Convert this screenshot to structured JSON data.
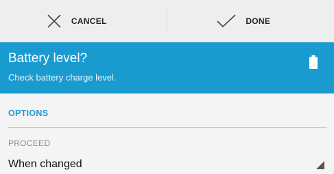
{
  "action_bar": {
    "cancel_label": "CANCEL",
    "done_label": "DONE",
    "cancel_icon": "close-icon",
    "done_icon": "check-icon"
  },
  "header": {
    "title": "Battery level?",
    "subtitle": "Check battery charge level.",
    "icon": "battery-icon",
    "background_color": "#1a9bd0"
  },
  "options": {
    "section_title": "OPTIONS",
    "field_label": "PROCEED",
    "field_value": "When changed"
  },
  "colors": {
    "accent": "#1a9bd0"
  }
}
